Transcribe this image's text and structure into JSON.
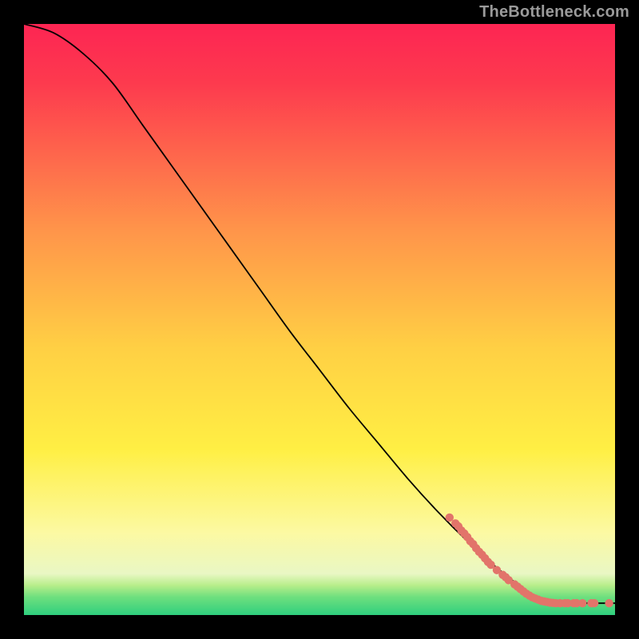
{
  "attribution": "TheBottleneck.com",
  "chart_data": {
    "type": "line",
    "title": "",
    "xlabel": "",
    "ylabel": "",
    "xlim": [
      0,
      100
    ],
    "ylim": [
      0,
      100
    ],
    "background_gradient": [
      "#fd2553",
      "#ffec3f",
      "#c1f15a",
      "#31d17e"
    ],
    "series": [
      {
        "name": "curve",
        "x": [
          0,
          5,
          10,
          15,
          20,
          25,
          30,
          35,
          40,
          45,
          50,
          55,
          60,
          65,
          70,
          75,
          80,
          85,
          86,
          88,
          90,
          92,
          94,
          96,
          98,
          100
        ],
        "y": [
          100,
          98.5,
          95,
          90,
          83,
          76,
          69,
          62,
          55,
          48,
          41.5,
          35,
          29,
          23,
          17.5,
          12.5,
          8,
          4,
          3.2,
          2.5,
          2.2,
          2.0,
          2.0,
          2.0,
          2.0,
          2.0
        ]
      }
    ],
    "points": [
      {
        "x": 72,
        "y": 16.5
      },
      {
        "x": 73,
        "y": 15.5
      },
      {
        "x": 73.5,
        "y": 15.0
      },
      {
        "x": 74,
        "y": 14.3
      },
      {
        "x": 74.5,
        "y": 13.8
      },
      {
        "x": 75,
        "y": 13.2
      },
      {
        "x": 75.5,
        "y": 12.5
      },
      {
        "x": 76,
        "y": 12.0
      },
      {
        "x": 76.5,
        "y": 11.3
      },
      {
        "x": 77,
        "y": 10.7
      },
      {
        "x": 77.5,
        "y": 10.2
      },
      {
        "x": 78,
        "y": 9.6
      },
      {
        "x": 78.5,
        "y": 9.0
      },
      {
        "x": 79,
        "y": 8.5
      },
      {
        "x": 80,
        "y": 7.6
      },
      {
        "x": 81,
        "y": 6.8
      },
      {
        "x": 81.5,
        "y": 6.4
      },
      {
        "x": 82,
        "y": 5.9
      },
      {
        "x": 83,
        "y": 5.2
      },
      {
        "x": 83.5,
        "y": 4.8
      },
      {
        "x": 84,
        "y": 4.4
      },
      {
        "x": 84.5,
        "y": 4.0
      },
      {
        "x": 85,
        "y": 3.6
      },
      {
        "x": 85.5,
        "y": 3.3
      },
      {
        "x": 86,
        "y": 3.0
      },
      {
        "x": 86.5,
        "y": 2.8
      },
      {
        "x": 87,
        "y": 2.6
      },
      {
        "x": 87.5,
        "y": 2.4
      },
      {
        "x": 88,
        "y": 2.3
      },
      {
        "x": 88.5,
        "y": 2.2
      },
      {
        "x": 89,
        "y": 2.1
      },
      {
        "x": 89.5,
        "y": 2.05
      },
      {
        "x": 90,
        "y": 2.0
      },
      {
        "x": 90.7,
        "y": 2.0
      },
      {
        "x": 91.5,
        "y": 2.0
      },
      {
        "x": 92,
        "y": 2.0
      },
      {
        "x": 93,
        "y": 2.0
      },
      {
        "x": 93.5,
        "y": 2.0
      },
      {
        "x": 94.5,
        "y": 2.0
      },
      {
        "x": 96,
        "y": 2.0
      },
      {
        "x": 96.5,
        "y": 2.0
      },
      {
        "x": 99,
        "y": 2.0
      }
    ]
  }
}
